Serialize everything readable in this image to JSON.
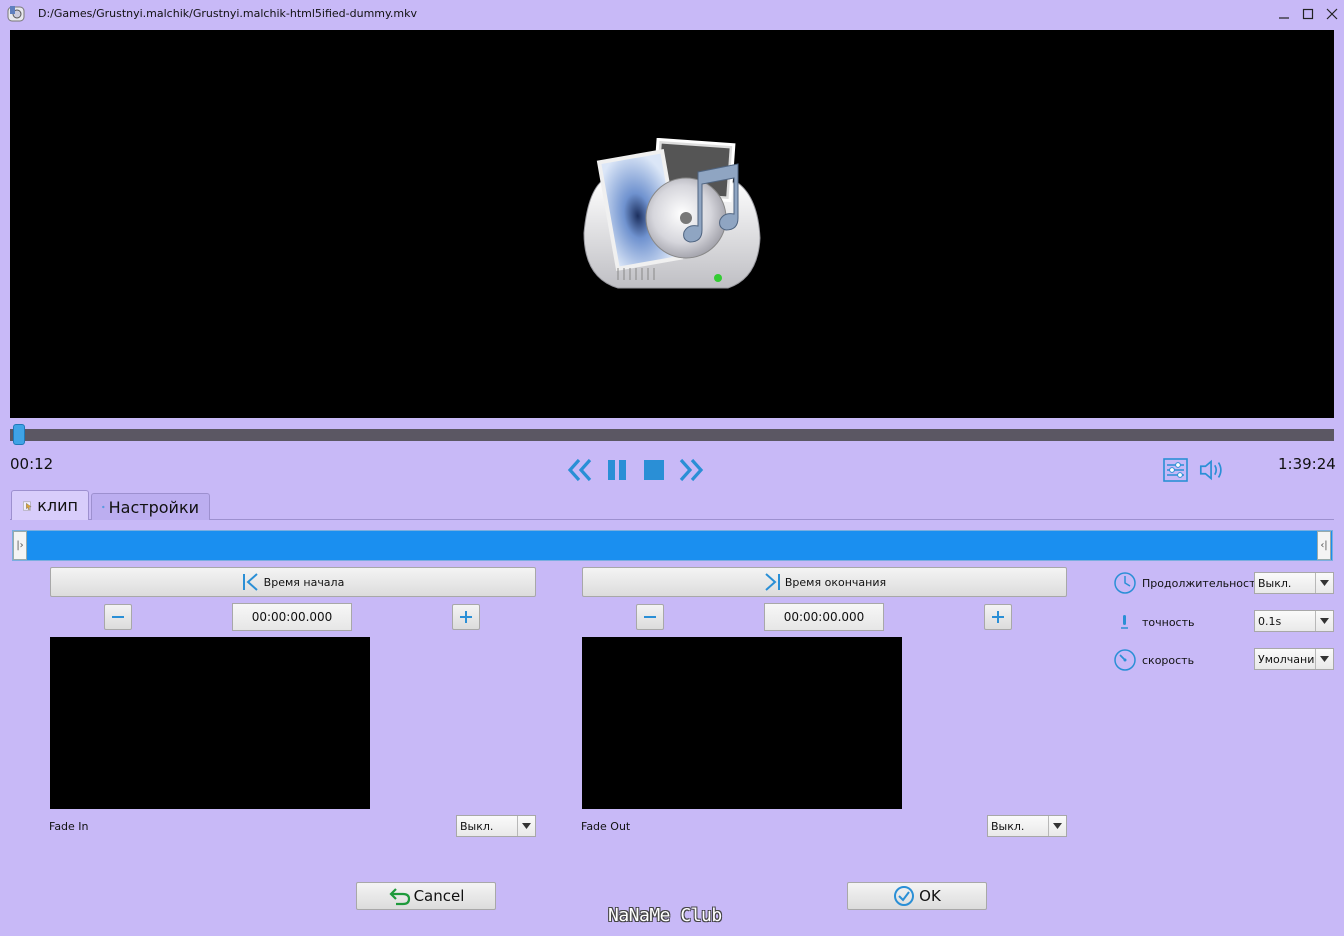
{
  "window": {
    "title": "D:/Games/Grustnyi.malchik/Grustnyi.malchik-html5ified-dummy.mkv",
    "controls": [
      "minimize-icon",
      "maximize-icon",
      "close-icon"
    ]
  },
  "player": {
    "time_current": "00:12",
    "time_total": "1:39:24",
    "seek_progress": 0.002,
    "controls": [
      "rewind-icon",
      "pause-icon",
      "stop-icon",
      "fast-forward-icon",
      "adjust-icon",
      "volume-icon"
    ]
  },
  "tabs": [
    {
      "label": "клип",
      "icon": "clip-icon",
      "active": true
    },
    {
      "label": "Настройки",
      "icon": "gear-icon",
      "active": false
    }
  ],
  "trim": {
    "start": {
      "button_label": "Время начала",
      "time_value": "00:00:00.000",
      "fade_label": "Fade In",
      "fade_value": "Выкл."
    },
    "end": {
      "button_label": "Время окончания",
      "time_value": "00:00:00.000",
      "fade_label": "Fade Out",
      "fade_value": "Выкл."
    }
  },
  "options": {
    "duration": {
      "label": "Продолжительность",
      "value": "Выкл."
    },
    "precision": {
      "label": "точность",
      "value": "0.1s"
    },
    "speed": {
      "label": "скорость",
      "value": "Умолчания"
    }
  },
  "footer": {
    "cancel_label": "Cancel",
    "ok_label": "OK",
    "watermark": "NaNaMe Club"
  },
  "colors": {
    "background": "#c8b9f7",
    "accent": "#1a8ff0",
    "icon": "#2a8fd6"
  }
}
